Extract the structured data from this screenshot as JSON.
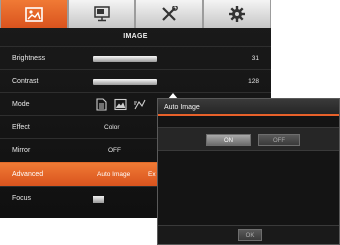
{
  "tabs": [
    {
      "name": "image-tab",
      "icon": "image-icon",
      "active": true
    },
    {
      "name": "display-tab",
      "icon": "monitor-icon",
      "active": false
    },
    {
      "name": "tools-tab",
      "icon": "tools-icon",
      "active": false
    },
    {
      "name": "settings-tab",
      "icon": "gear-icon",
      "active": false
    }
  ],
  "header": "IMAGE",
  "rows": {
    "brightness": {
      "label": "Brightness",
      "value": "31"
    },
    "contrast": {
      "label": "Contrast",
      "value": "128"
    },
    "mode": {
      "label": "Mode",
      "icons": [
        "document-icon",
        "photo-icon",
        "motion-icon"
      ]
    },
    "effect": {
      "label": "Effect",
      "value": "Color"
    },
    "mirror": {
      "label": "Mirror",
      "value": "OFF"
    },
    "advanced": {
      "label": "Advanced",
      "value": "Auto Image",
      "value2": "Ex"
    },
    "focus": {
      "label": "Focus"
    }
  },
  "popup": {
    "title": "Auto Image",
    "on_label": "ON",
    "off_label": "OFF",
    "ok_label": "OK"
  },
  "colors": {
    "accent": "#e8612a",
    "panel": "#141414",
    "tab": "#d8d8d8"
  }
}
